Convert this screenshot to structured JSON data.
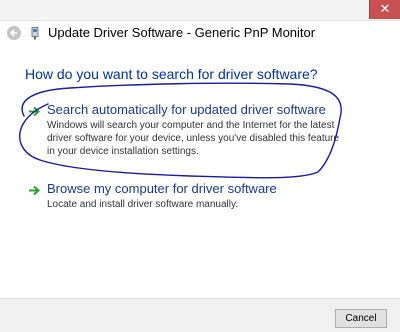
{
  "window": {
    "title": "Update Driver Software - Generic PnP Monitor",
    "close_glyph": "✕"
  },
  "main": {
    "heading": "How do you want to search for driver software?",
    "options": [
      {
        "title": "Search automatically for updated driver software",
        "description": "Windows will search your computer and the Internet for the latest driver software for your device, unless you've disabled this feature in your device installation settings."
      },
      {
        "title": "Browse my computer for driver software",
        "description": "Locate and install driver software manually."
      }
    ]
  },
  "footer": {
    "cancel_label": "Cancel"
  },
  "icons": {
    "back": "back-arrow-icon",
    "device": "device-manager-icon",
    "option_arrow": "green-arrow-icon",
    "close": "close-icon"
  },
  "colors": {
    "heading": "#003399",
    "option_title": "#1a3a8a",
    "arrow": "#2ca02c",
    "close_button": "#c75050",
    "annotation_ink": "#1a1aa8"
  }
}
